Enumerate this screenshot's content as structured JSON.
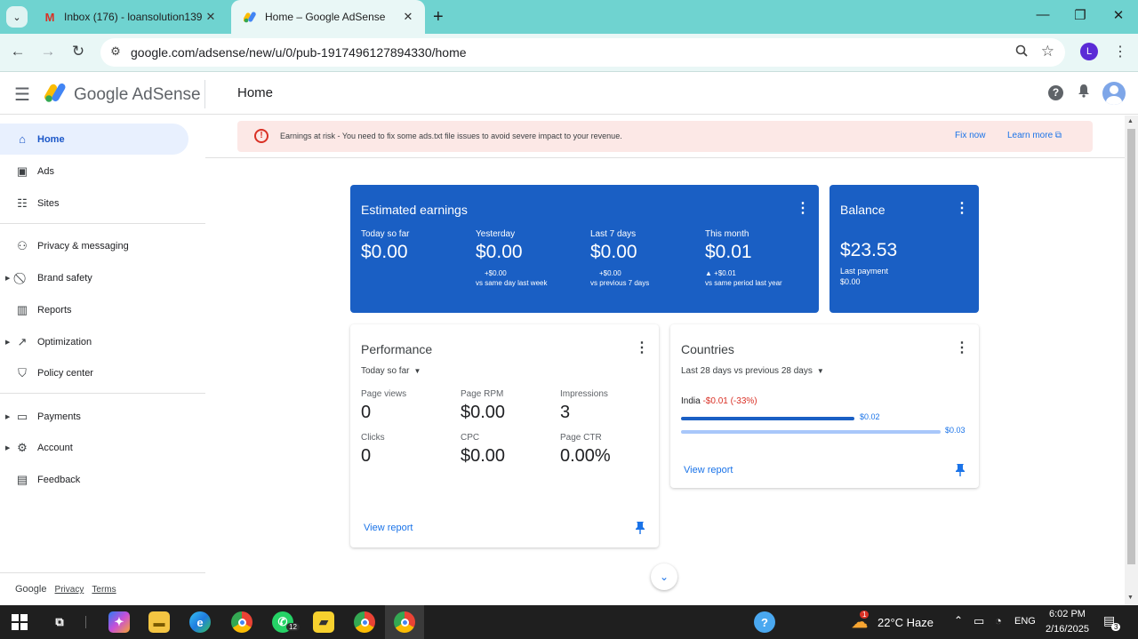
{
  "browser": {
    "tabs": [
      {
        "title": "Inbox (176) - loansolution139@",
        "favicon": "gmail-icon"
      },
      {
        "title": "Home – Google AdSense",
        "favicon": "adsense-icon"
      }
    ],
    "url": "google.com/adsense/new/u/0/pub-1917496127894330/home",
    "profile_initial": "L"
  },
  "header": {
    "brand": "Google AdSense",
    "page_title": "Home"
  },
  "sidebar": {
    "items": [
      {
        "label": "Home",
        "icon": "home-icon"
      },
      {
        "label": "Ads",
        "icon": "ads-icon"
      },
      {
        "label": "Sites",
        "icon": "sites-icon"
      },
      {
        "label": "Privacy & messaging",
        "icon": "privacy-icon"
      },
      {
        "label": "Brand safety",
        "icon": "block-icon"
      },
      {
        "label": "Reports",
        "icon": "reports-icon"
      },
      {
        "label": "Optimization",
        "icon": "trending-icon"
      },
      {
        "label": "Policy center",
        "icon": "policy-icon"
      },
      {
        "label": "Payments",
        "icon": "payments-icon"
      },
      {
        "label": "Account",
        "icon": "gear-icon"
      },
      {
        "label": "Feedback",
        "icon": "feedback-icon"
      }
    ],
    "footer": {
      "google": "Google",
      "privacy": "Privacy",
      "terms": "Terms"
    }
  },
  "alert": {
    "message": "Earnings at risk - You need to fix some ads.txt file issues to avoid severe impact to your revenue.",
    "fix_label": "Fix now",
    "learn_label": "Learn more"
  },
  "earnings": {
    "title": "Estimated earnings",
    "metrics": [
      {
        "label": "Today so far",
        "value": "$0.00",
        "delta": "",
        "compare": ""
      },
      {
        "label": "Yesterday",
        "value": "$0.00",
        "delta": "+$0.00",
        "compare": "vs same day last week"
      },
      {
        "label": "Last 7 days",
        "value": "$0.00",
        "delta": "+$0.00",
        "compare": "vs previous 7 days"
      },
      {
        "label": "This month",
        "value": "$0.01",
        "delta": "▲ +$0.01",
        "compare": "vs same period last year"
      }
    ]
  },
  "balance": {
    "title": "Balance",
    "value": "$23.53",
    "last_payment_label": "Last payment",
    "last_payment_value": "$0.00"
  },
  "performance": {
    "title": "Performance",
    "range": "Today so far",
    "metrics": [
      {
        "label": "Page views",
        "value": "0"
      },
      {
        "label": "Page RPM",
        "value": "$0.00"
      },
      {
        "label": "Impressions",
        "value": "3"
      },
      {
        "label": "Clicks",
        "value": "0"
      },
      {
        "label": "CPC",
        "value": "$0.00"
      },
      {
        "label": "Page CTR",
        "value": "0.00%"
      }
    ],
    "view_report": "View report"
  },
  "countries": {
    "title": "Countries",
    "range": "Last 28 days vs previous 28 days",
    "country": "India",
    "change": "-$0.01 (-33%)",
    "current_value": "$0.02",
    "previous_value": "$0.03",
    "current_fraction": 0.667,
    "previous_fraction": 1.0,
    "view_report": "View report"
  },
  "taskbar": {
    "weather": "22°C  Haze",
    "lang": "ENG",
    "time": "6:02 PM",
    "date": "2/16/2025",
    "whatsapp_badge": "12",
    "notif_badge": "3",
    "weather_badge": "1"
  },
  "colors": {
    "accent": "#1a73e8",
    "card_blue": "#1a5fc4",
    "alert_bg": "#fce8e6",
    "error": "#d93025"
  }
}
